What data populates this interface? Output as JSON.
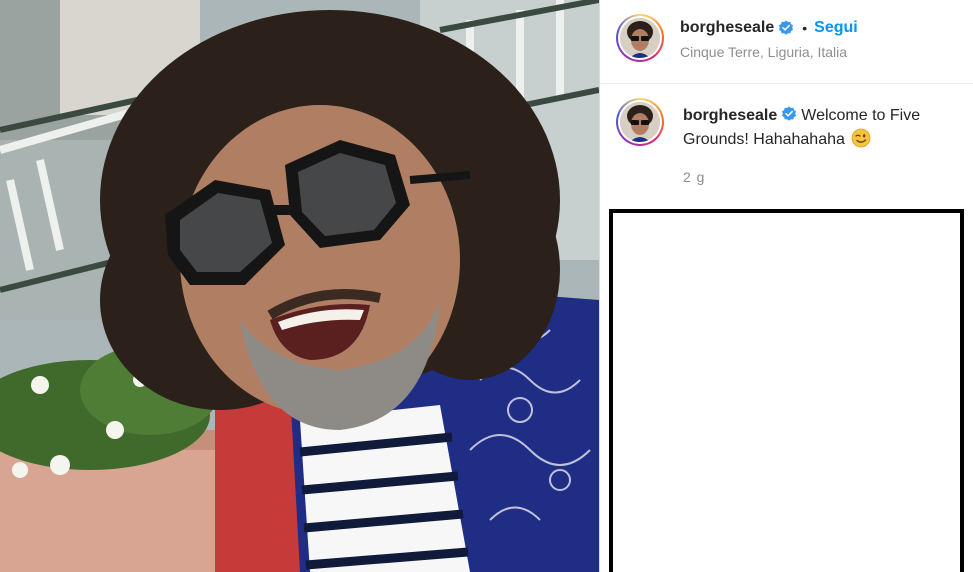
{
  "post": {
    "image_alt": "Selfie of a smiling man with curly hair, oversized sunglasses and a paisley bandana shirt",
    "header": {
      "username": "borgheseale",
      "verified": true,
      "separator": "•",
      "follow_label": "Segui",
      "location": "Cinque Terre, Liguria, Italia"
    },
    "caption": {
      "username": "borgheseale",
      "text": "Welcome to Five Grounds! Hahahahaha",
      "emoji": "winking-face-icon"
    },
    "age": "2 g"
  },
  "colors": {
    "accent": "#0095f6",
    "verified_badge": "#3897f0",
    "muted_text": "#8e8e8e",
    "text": "#262626"
  }
}
